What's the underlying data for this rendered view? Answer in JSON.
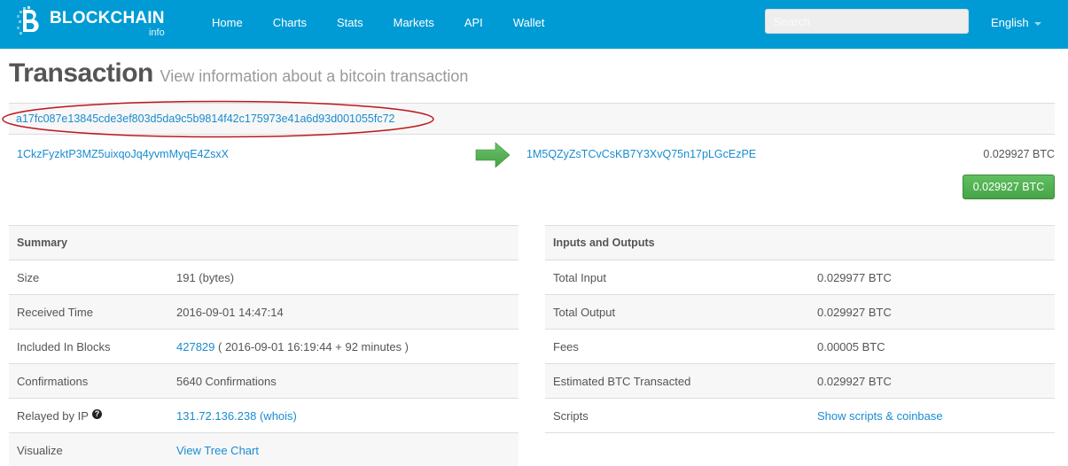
{
  "navbar": {
    "brand_name": "BLOCKCHAIN",
    "brand_sub": "info",
    "items": [
      "Home",
      "Charts",
      "Stats",
      "Markets",
      "API",
      "Wallet"
    ],
    "search_placeholder": "Search",
    "language": "English"
  },
  "page": {
    "title": "Transaction",
    "subtitle": "View information about a bitcoin transaction"
  },
  "transaction": {
    "hash": "a17fc087e13845cde3ef803d5da9c5b9814f42c175973e41a6d93d001055fc72",
    "input_address": "1CkzFyzktP3MZ5uixqoJq4yvmMyqE4ZsxX",
    "output_address": "1M5QZyZsTCvCsKB7Y3XvQ75n17pLGcEzPE",
    "output_amount": "0.029927 BTC",
    "total_button": "0.029927 BTC"
  },
  "summary": {
    "heading": "Summary",
    "size_label": "Size",
    "size_value": "191 (bytes)",
    "received_label": "Received Time",
    "received_value": "2016-09-01 14:47:14",
    "blocks_label": "Included In Blocks",
    "block_link": "427829",
    "block_detail": " ( 2016-09-01 16:19:44 + 92 minutes )",
    "confirmations_label": "Confirmations",
    "confirmations_value": "5640 Confirmations",
    "relayed_label": "Relayed by IP",
    "relayed_value": "131.72.136.238 (whois)",
    "visualize_label": "Visualize",
    "visualize_value": "View Tree Chart"
  },
  "io": {
    "heading": "Inputs and Outputs",
    "total_input_label": "Total Input",
    "total_input_value": "0.029977 BTC",
    "total_output_label": "Total Output",
    "total_output_value": "0.029927 BTC",
    "fees_label": "Fees",
    "fees_value": "0.00005 BTC",
    "estimated_label": "Estimated BTC Transacted",
    "estimated_value": "0.029927 BTC",
    "scripts_label": "Scripts",
    "scripts_value": "Show scripts & coinbase"
  },
  "icons": {
    "help": "?"
  },
  "colors": {
    "navbar": "#009bd4",
    "link": "#1a8cd0",
    "success": "#47a447",
    "annotation": "#c0161c"
  }
}
